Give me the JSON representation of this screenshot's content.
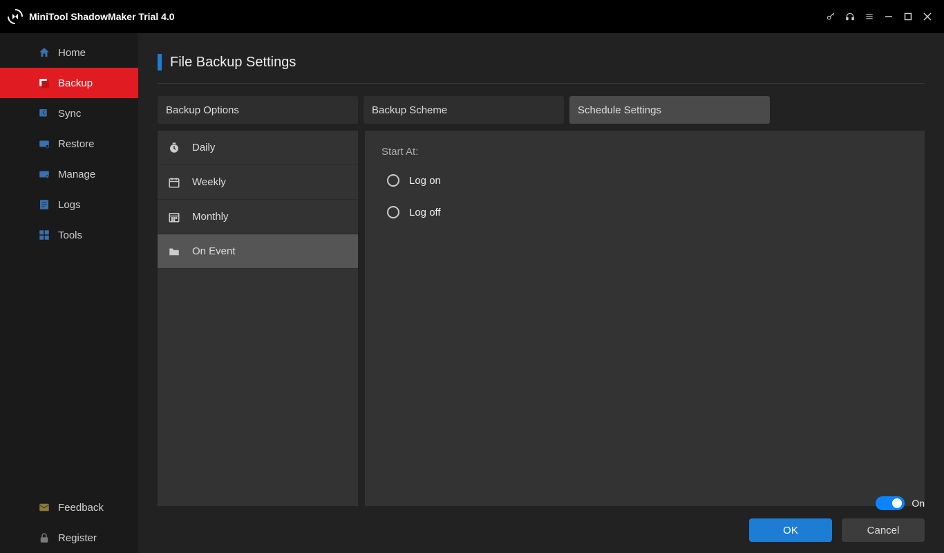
{
  "app": {
    "title": "MiniTool ShadowMaker Trial 4.0"
  },
  "sidebar": {
    "items": [
      {
        "label": "Home"
      },
      {
        "label": "Backup"
      },
      {
        "label": "Sync"
      },
      {
        "label": "Restore"
      },
      {
        "label": "Manage"
      },
      {
        "label": "Logs"
      },
      {
        "label": "Tools"
      }
    ],
    "footer": {
      "feedback": "Feedback",
      "register": "Register"
    }
  },
  "page": {
    "title": "File Backup Settings"
  },
  "tabs": [
    {
      "label": "Backup Options"
    },
    {
      "label": "Backup Scheme"
    },
    {
      "label": "Schedule Settings"
    }
  ],
  "schedule": {
    "modes": [
      {
        "label": "Daily"
      },
      {
        "label": "Weekly"
      },
      {
        "label": "Monthly"
      },
      {
        "label": "On Event"
      }
    ],
    "detail": {
      "start_at_label": "Start At:",
      "options": [
        {
          "label": "Log on"
        },
        {
          "label": "Log off"
        }
      ]
    }
  },
  "toggle": {
    "label": "On"
  },
  "buttons": {
    "ok": "OK",
    "cancel": "Cancel"
  }
}
